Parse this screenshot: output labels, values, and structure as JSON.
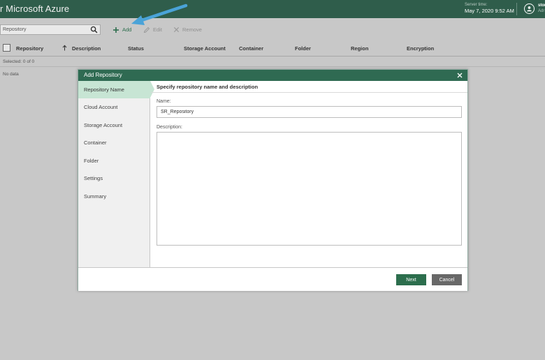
{
  "header": {
    "app_title": "r Microsoft Azure",
    "server_time_label": "Server time:",
    "server_time_value": "May 7, 2020 9:52 AM",
    "user_name": "stor",
    "user_role": "Adr"
  },
  "toolbar": {
    "search_placeholder": "Repository",
    "add_label": "Add",
    "edit_label": "Edit",
    "remove_label": "Remove"
  },
  "grid": {
    "columns": [
      "Repository",
      "Description",
      "Status",
      "Storage Account",
      "Container",
      "Folder",
      "Region",
      "Encryption"
    ],
    "selected_text": "Selected: 0 of 0",
    "empty_text": "No data"
  },
  "dialog": {
    "title": "Add Repository",
    "steps": [
      "Repository Name",
      "Cloud Account",
      "Storage Account",
      "Container",
      "Folder",
      "Settings",
      "Summary"
    ],
    "active_step": "Repository Name",
    "content_title": "Specify repository name and description",
    "name_label": "Name:",
    "name_value": "SR_Repository",
    "description_label": "Description:",
    "description_value": "",
    "next_label": "Next",
    "cancel_label": "Cancel"
  },
  "colors": {
    "brand_green": "#2f5d4b",
    "accent_green": "#2c6e4d",
    "active_step": "#c7e5d4",
    "annotation_arrow": "#4aa3d8"
  }
}
